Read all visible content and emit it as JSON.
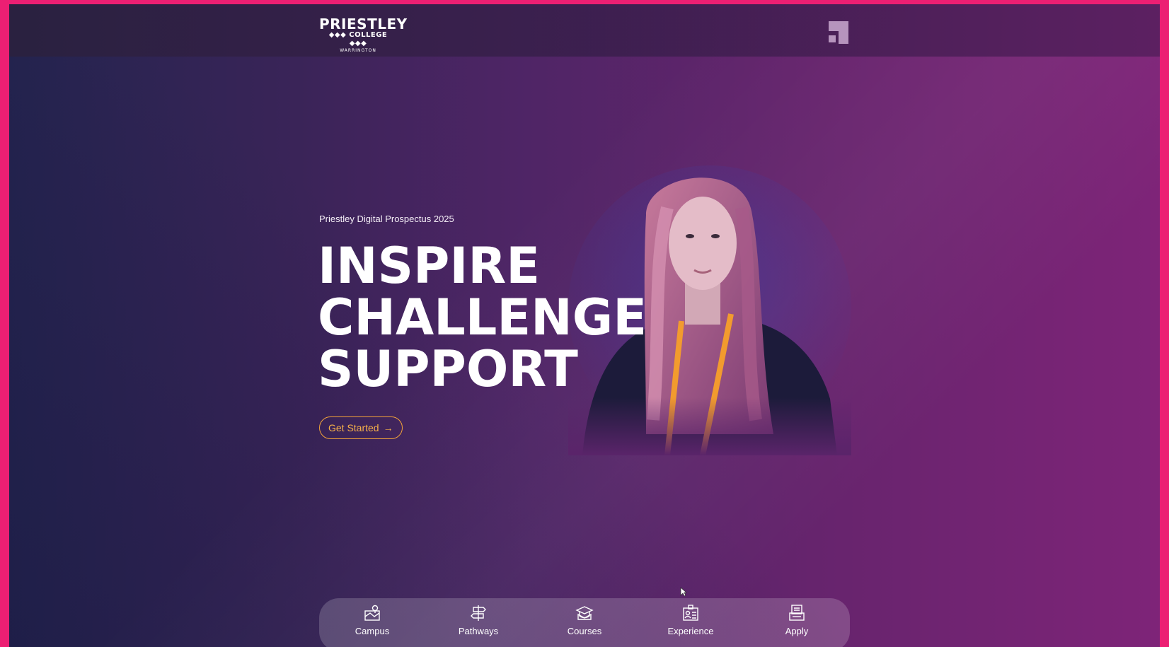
{
  "brand": {
    "name": "PRIESTLEY",
    "sub": "COLLEGE",
    "location": "WARRINGTON"
  },
  "hero": {
    "eyebrow": "Priestley Digital Prospectus 2025",
    "lines": [
      "INSPIRE",
      "CHALLENGE",
      "SUPPORT"
    ],
    "cta_label": "Get Started",
    "cta_arrow": "→"
  },
  "nav": {
    "items": [
      {
        "label": "Campus",
        "icon": "campus-map-icon"
      },
      {
        "label": "Pathways",
        "icon": "signpost-icon"
      },
      {
        "label": "Courses",
        "icon": "graduation-cap-icon"
      },
      {
        "label": "Experience",
        "icon": "id-card-icon"
      },
      {
        "label": "Apply",
        "icon": "application-form-icon"
      }
    ]
  },
  "colors": {
    "accent": "#f2a23a",
    "frame": "#ec1f73"
  }
}
